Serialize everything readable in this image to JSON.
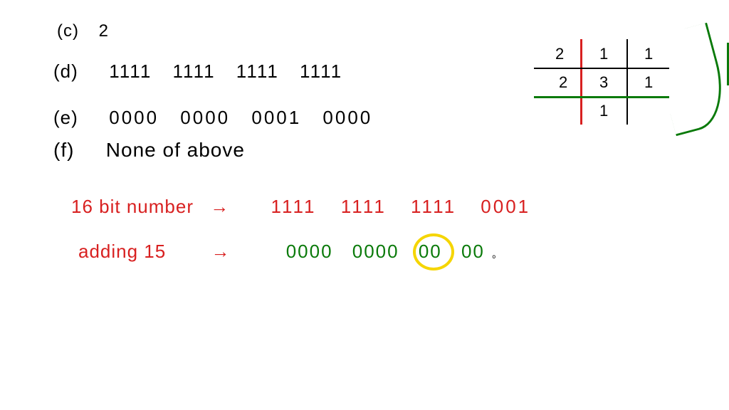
{
  "options": {
    "c_label": "(c)",
    "c_value": "2",
    "d_label": "(d)",
    "d_value": "1111  1111  1111  1111",
    "e_label": "(e)",
    "e_value": "0000  0000  0001  0000",
    "f_label": "(f)",
    "f_value": "None of above"
  },
  "working": {
    "line1_label": "16 bit number",
    "arrow": "→",
    "line1_binary": "1111  1111  1111  0001",
    "line2_label": "adding 15",
    "line2_binary_green": "0000  0000  00 00",
    "line2_dot": "。"
  },
  "table": {
    "r1c1": "2",
    "r1c2": "1",
    "r1c3": "1",
    "r2c1": "2",
    "r2c2": "3",
    "r2c3": "1",
    "r3c2": "1"
  }
}
